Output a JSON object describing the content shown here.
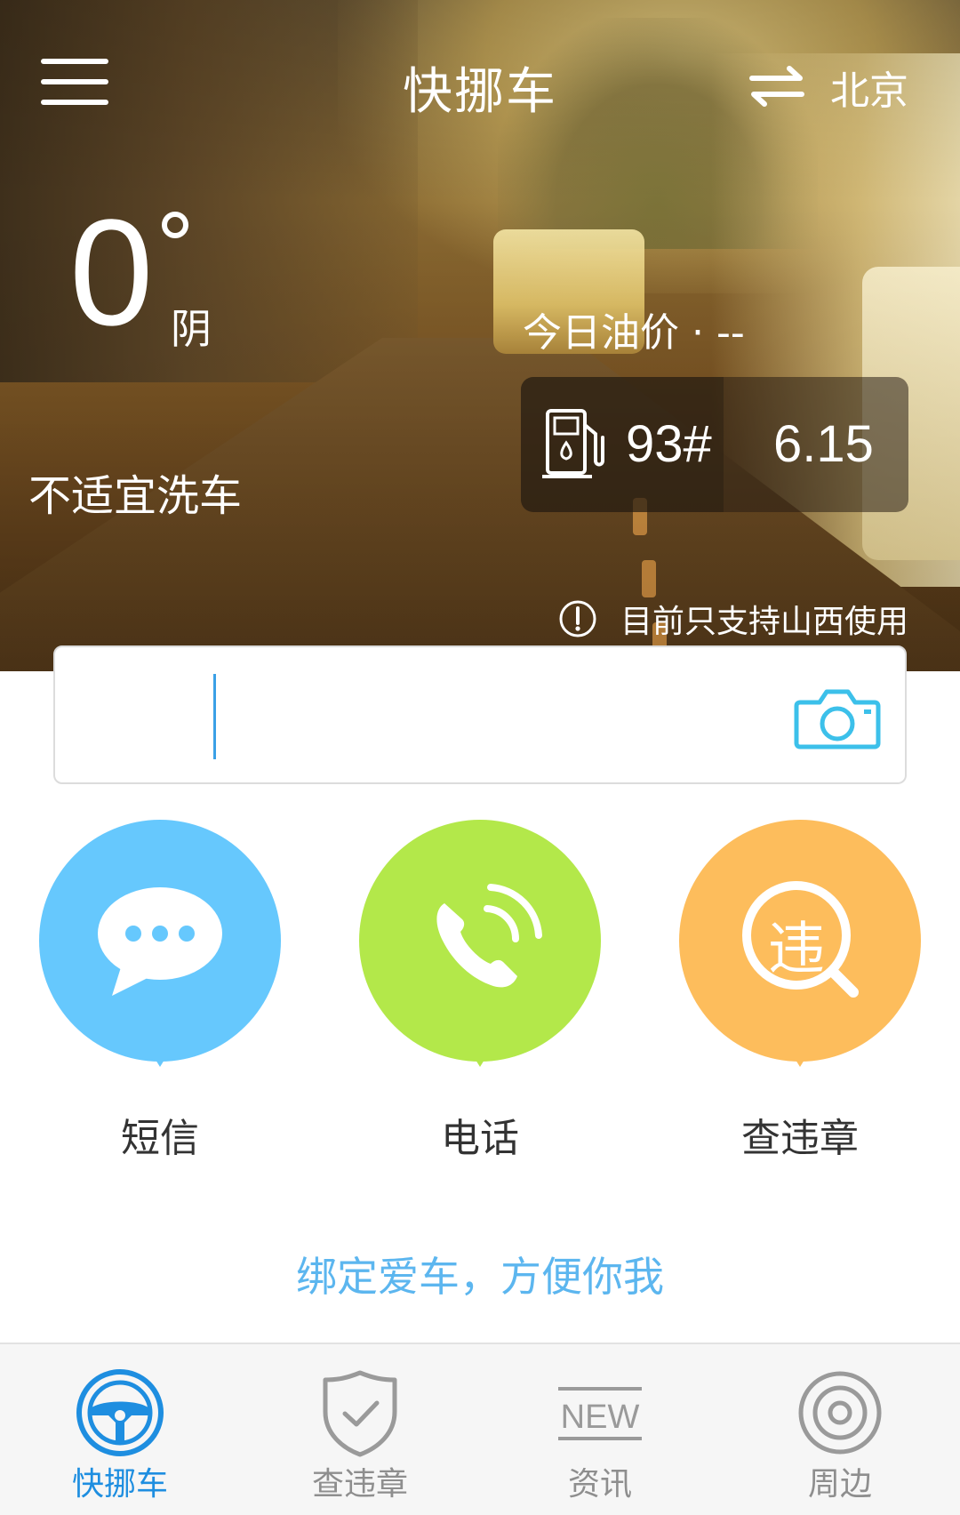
{
  "header": {
    "title": "快挪车",
    "city": "北京"
  },
  "weather": {
    "temperature": "0",
    "condition": "阴",
    "wash_advice": "不适宜洗车"
  },
  "oil": {
    "title": "今日油价 · --",
    "grade": "93#",
    "price": "6.15"
  },
  "notice": {
    "text": "目前只支持山西使用"
  },
  "search": {
    "value": "",
    "placeholder": ""
  },
  "actions": [
    {
      "label": "短信",
      "color": "#66c8fd"
    },
    {
      "label": "电话",
      "color": "#b3e84a"
    },
    {
      "label": "查违章",
      "color": "#fdbd5c"
    }
  ],
  "violation_icon_char": "违",
  "bind_prompt": "绑定爱车，方便你我",
  "tabs": [
    {
      "label": "快挪车",
      "icon": "steering-wheel-icon",
      "active": true
    },
    {
      "label": "查违章",
      "icon": "shield-check-icon",
      "active": false
    },
    {
      "label": "资讯",
      "icon": "new-icon",
      "active": false,
      "badge": "NEW"
    },
    {
      "label": "周边",
      "icon": "target-icon",
      "active": false
    }
  ],
  "colors": {
    "accent": "#1e8ee0",
    "bind_text": "#5cb6ef",
    "camera": "#3cc0ea"
  }
}
